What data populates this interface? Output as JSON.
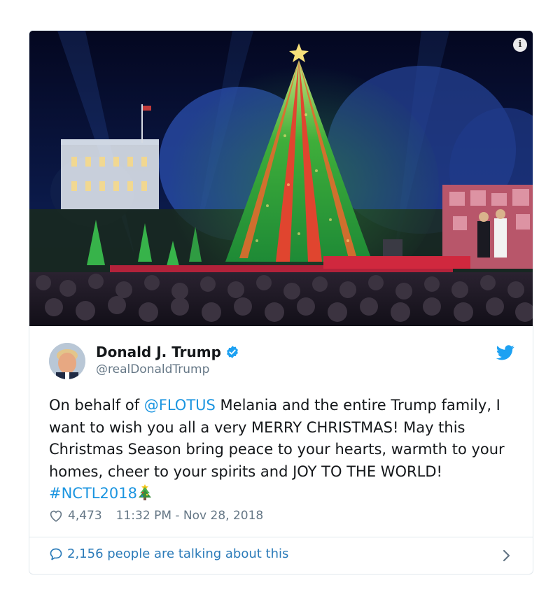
{
  "tweet": {
    "author": {
      "name": "Donald J. Trump",
      "handle": "@realDonaldTrump",
      "verified": true
    },
    "text": {
      "before_mention": "On behalf of ",
      "mention": "@FLOTUS",
      "middle": " Melania and the entire Trump family, I want to wish you all a very MERRY CHRISTMAS! May this Christmas Season bring peace to your hearts, warmth to your homes, cheer to your spirits and JOY TO THE WORLD! ",
      "hashtag": "#NCTL2018"
    },
    "likes": "4,473",
    "timestamp": "11:32 PM - Nov 28, 2018",
    "talking": "2,156 people are talking about this"
  },
  "icons": {
    "info": "info-icon",
    "verified": "verified-badge-icon",
    "bird": "twitter-bird-icon",
    "heart": "heart-icon",
    "bubble": "speech-bubble-icon",
    "chevron": "chevron-right-icon",
    "tree": "christmas-tree-emoji"
  },
  "colors": {
    "link": "#1b95e0",
    "twitter_blue": "#1da1f2",
    "meta_gray": "#657786",
    "border": "#e1e8ed"
  }
}
